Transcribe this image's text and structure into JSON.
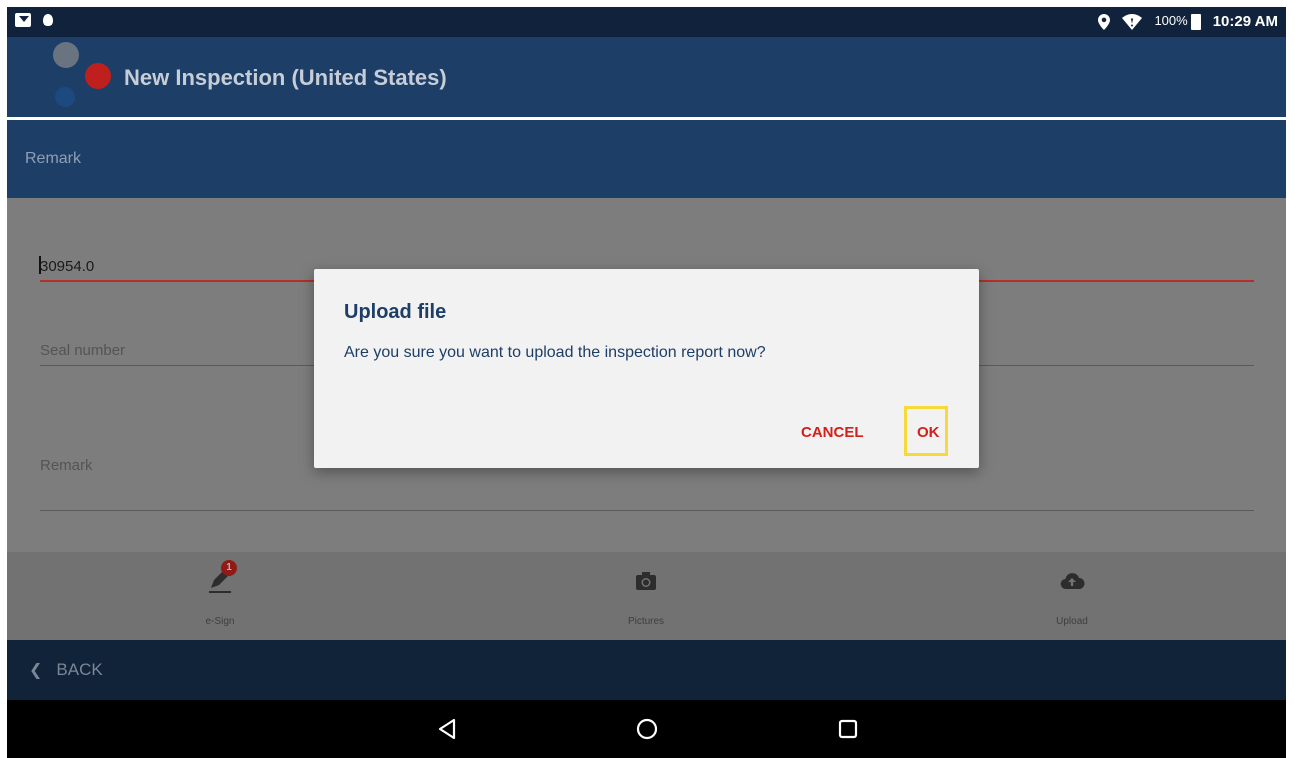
{
  "status_bar": {
    "battery": "100%",
    "time": "10:29 AM",
    "icons": [
      "notification-icon",
      "app-notification-icon",
      "location-icon",
      "wifi-icon",
      "battery-icon"
    ]
  },
  "app_bar": {
    "title": "New Inspection (United States)"
  },
  "section": {
    "title": "Remark"
  },
  "form": {
    "value_field": "30954.0",
    "seal_label": "Seal number",
    "remark_label": "Remark"
  },
  "bottom_nav": {
    "items": [
      {
        "label": "e-Sign",
        "icon": "pen-icon",
        "badge": "1"
      },
      {
        "label": "Pictures",
        "icon": "camera-icon"
      },
      {
        "label": "Upload",
        "icon": "cloud-upload-icon"
      }
    ]
  },
  "back": {
    "label": "BACK"
  },
  "dialog": {
    "title": "Upload file",
    "message": "Are you sure you want to upload the inspection report now?",
    "cancel_label": "CANCEL",
    "ok_label": "OK"
  },
  "colors": {
    "app_bar": "#1d3e66",
    "status_bar": "#11233c",
    "accent_red": "#d3201b",
    "highlight": "#f7d93a"
  }
}
